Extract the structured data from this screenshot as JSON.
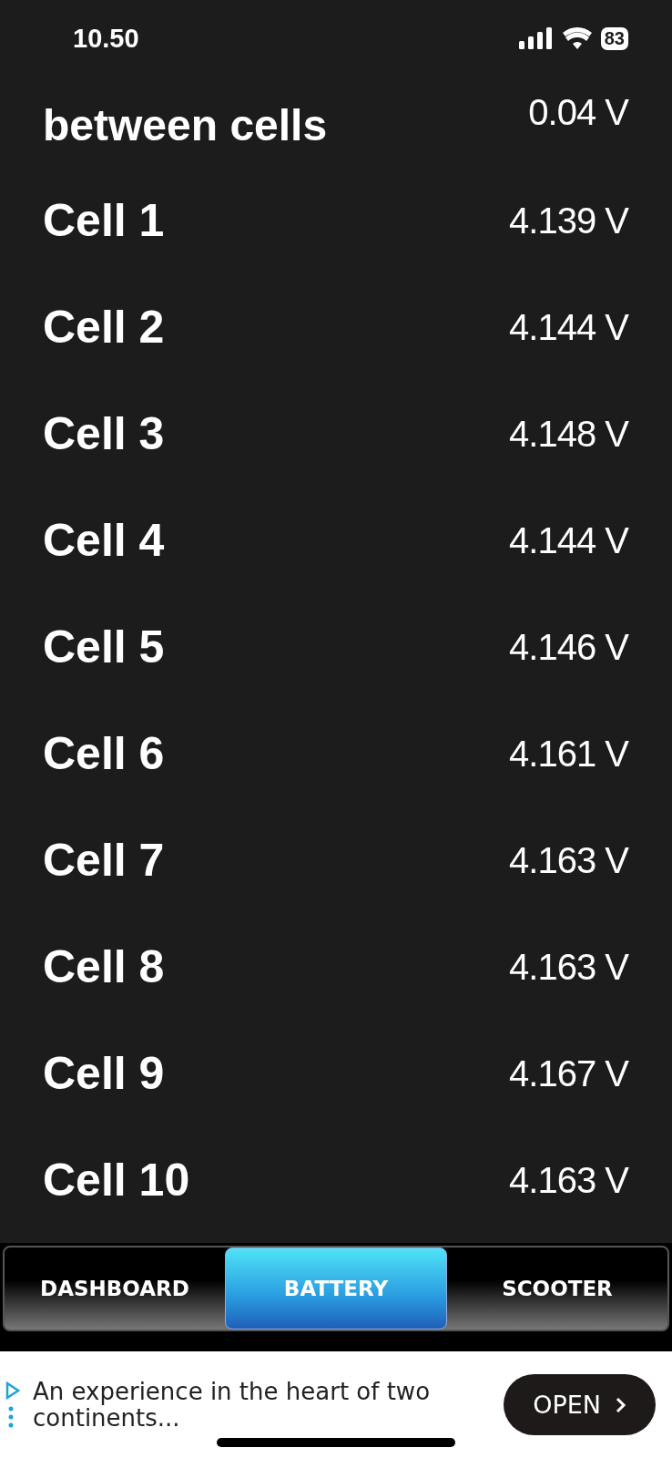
{
  "status_bar": {
    "time": "10.50",
    "battery": "83"
  },
  "rows": [
    {
      "label": "between cells",
      "value": "0.04 V"
    },
    {
      "label": "Cell 1",
      "value": "4.139 V"
    },
    {
      "label": "Cell 2",
      "value": "4.144 V"
    },
    {
      "label": "Cell 3",
      "value": "4.148 V"
    },
    {
      "label": "Cell 4",
      "value": "4.144 V"
    },
    {
      "label": "Cell 5",
      "value": "4.146 V"
    },
    {
      "label": "Cell 6",
      "value": "4.161 V"
    },
    {
      "label": "Cell 7",
      "value": "4.163 V"
    },
    {
      "label": "Cell 8",
      "value": "4.163 V"
    },
    {
      "label": "Cell 9",
      "value": "4.167 V"
    },
    {
      "label": "Cell 10",
      "value": "4.163 V"
    }
  ],
  "tabs": [
    {
      "label": "DASHBOARD",
      "selected": false
    },
    {
      "label": "BATTERY",
      "selected": true
    },
    {
      "label": "SCOOTER",
      "selected": false
    }
  ],
  "ad": {
    "text": "An experience in the heart of two continents...",
    "button": "OPEN"
  }
}
